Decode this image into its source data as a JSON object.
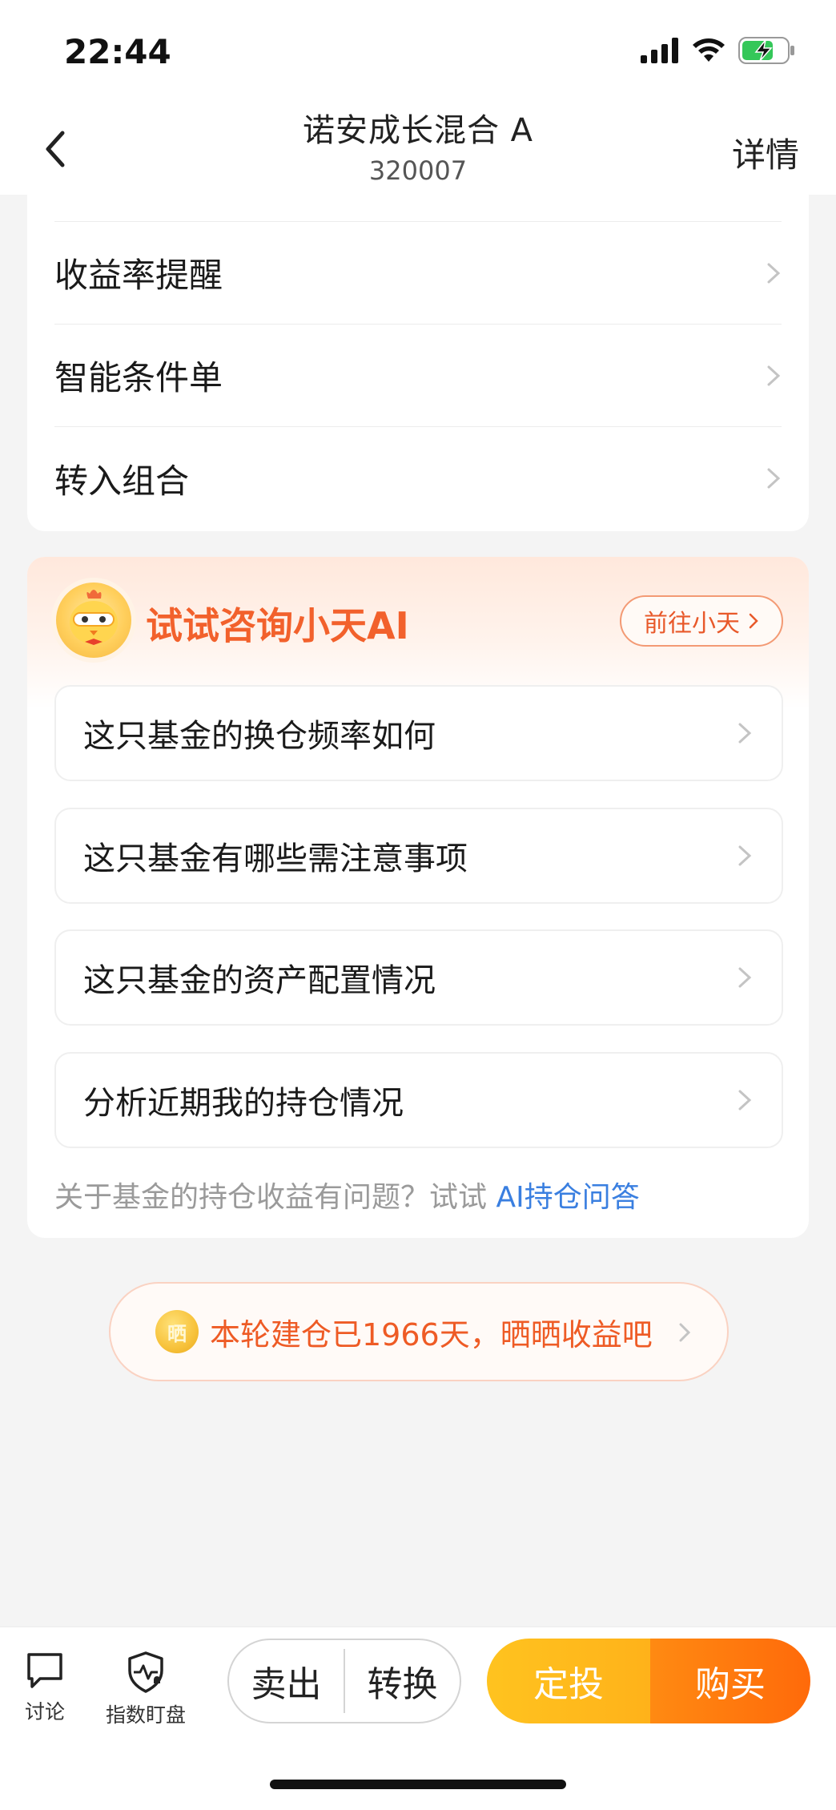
{
  "status_bar": {
    "time": "22:44"
  },
  "header": {
    "title": "诺安成长混合 A",
    "code": "320007",
    "detail_label": "详情"
  },
  "menu": {
    "items": [
      {
        "label": "收益率提醒"
      },
      {
        "label": "智能条件单"
      },
      {
        "label": "转入组合"
      }
    ]
  },
  "ai_card": {
    "title": "试试咨询小天AI",
    "go_button": "前往小天",
    "questions": [
      {
        "label": "这只基金的换仓频率如何"
      },
      {
        "label": "这只基金有哪些需注意事项"
      },
      {
        "label": "这只基金的资产配置情况"
      },
      {
        "label": "分析近期我的持仓情况"
      }
    ],
    "footer_prefix": "关于基金的持仓收益有问题？试试",
    "footer_link": "AI持仓问答"
  },
  "share": {
    "coin_char": "晒",
    "text": "本轮建仓已1966天，晒晒收益吧"
  },
  "bottom_bar": {
    "discuss_label": "讨论",
    "index_watch_label": "指数盯盘",
    "sell_label": "卖出",
    "convert_label": "转换",
    "sip_label": "定投",
    "buy_label": "购买"
  },
  "colors": {
    "accent_orange": "#f2612c",
    "link_blue": "#3a7fe0",
    "sip_yellow": "#ffb21a",
    "buy_orange": "#ff6a0a"
  }
}
